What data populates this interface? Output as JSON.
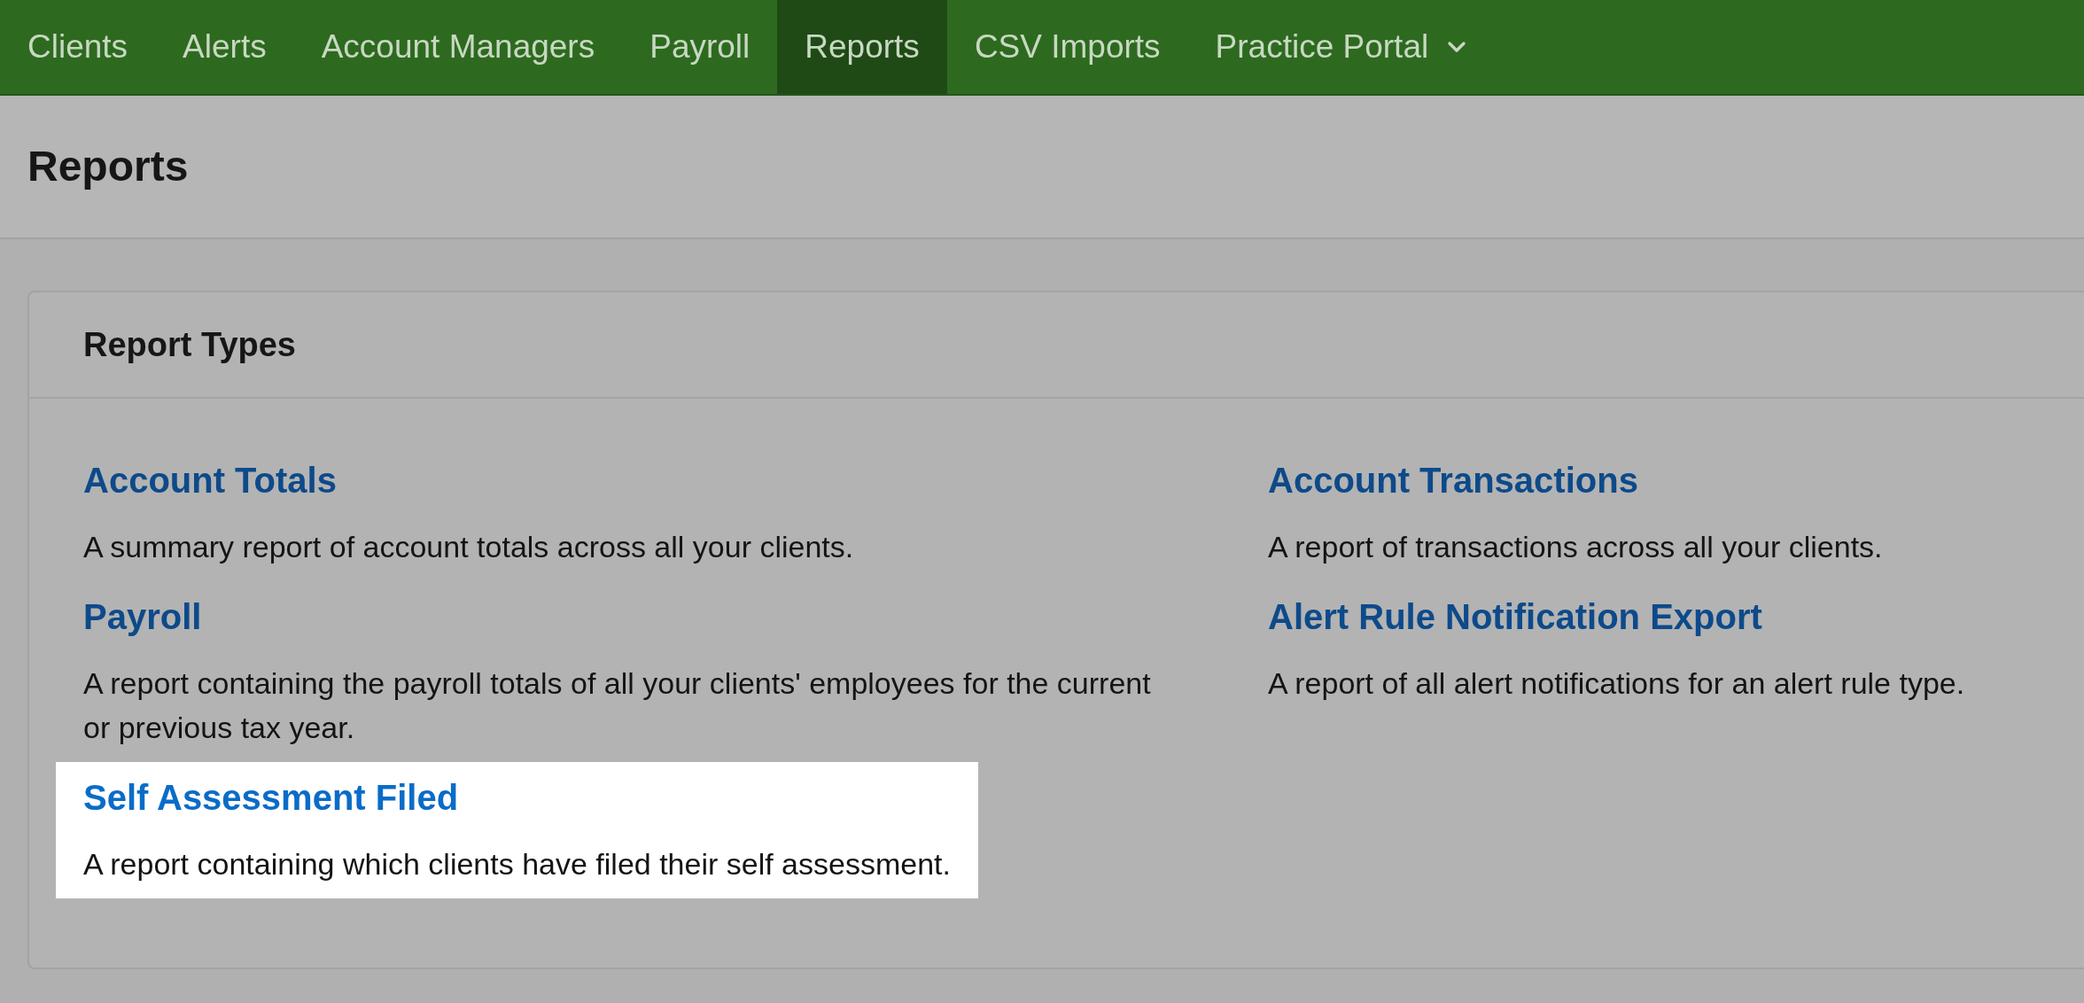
{
  "nav": [
    {
      "label": "Clients",
      "selected": false,
      "dropdown": false
    },
    {
      "label": "Alerts",
      "selected": false,
      "dropdown": false
    },
    {
      "label": "Account Managers",
      "selected": false,
      "dropdown": false
    },
    {
      "label": "Payroll",
      "selected": false,
      "dropdown": false
    },
    {
      "label": "Reports",
      "selected": true,
      "dropdown": false
    },
    {
      "label": "CSV Imports",
      "selected": false,
      "dropdown": false
    },
    {
      "label": "Practice Portal",
      "selected": false,
      "dropdown": true
    }
  ],
  "page_title": "Reports",
  "card": {
    "title": "Report Types",
    "reports": [
      {
        "title": "Account Totals",
        "description": "A summary report of account totals across all your clients.",
        "highlighted": false
      },
      {
        "title": "Account Transactions",
        "description": "A report of transactions across all your clients.",
        "highlighted": false
      },
      {
        "title": "Payroll",
        "description": "A report containing the payroll totals of all your clients' employees for the current or previous tax year.",
        "highlighted": false
      },
      {
        "title": "Alert Rule Notification Export",
        "description": "A report of all alert notifications for an alert rule type.",
        "highlighted": false
      },
      {
        "title": "Self Assessment Filed",
        "description": "A report containing which clients have filed their self assessment.",
        "highlighted": true
      }
    ]
  }
}
